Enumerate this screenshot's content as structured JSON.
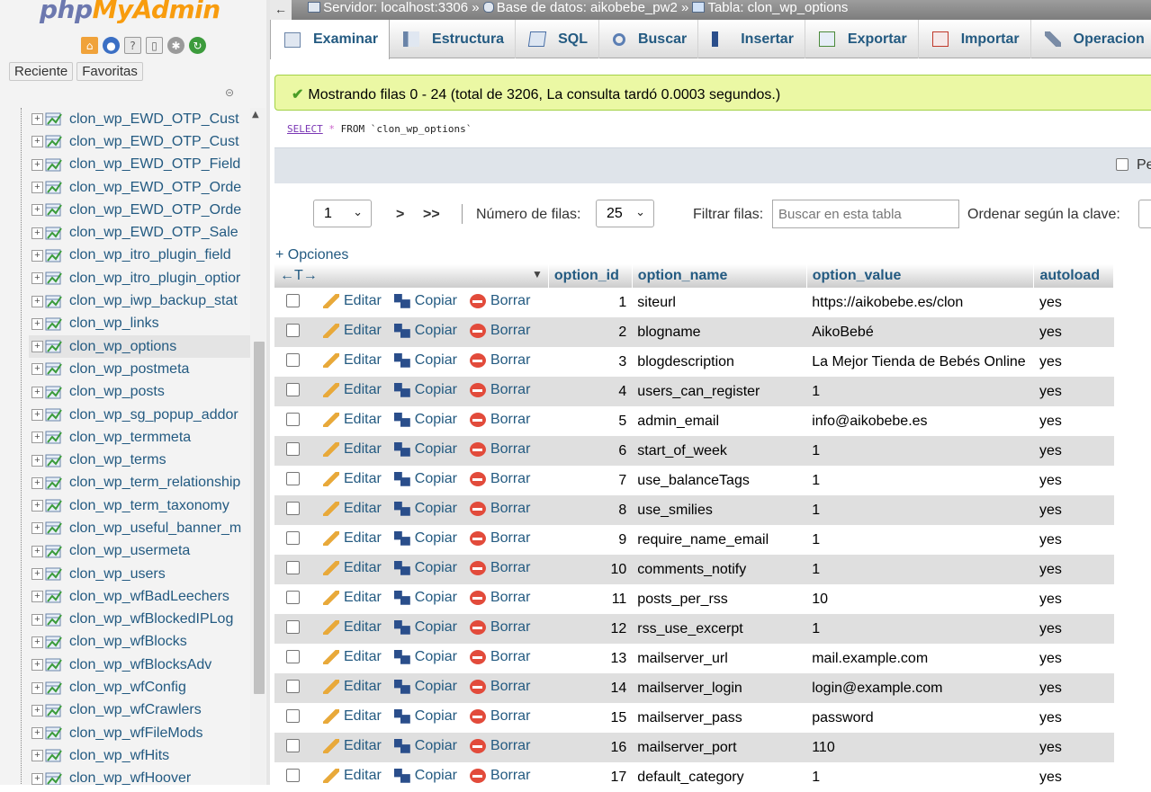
{
  "app": {
    "logo_php": "php",
    "logo_myadmin": "MyAdmin",
    "nav_tabs": [
      "Reciente",
      "Favoritas"
    ]
  },
  "tree": [
    {
      "name": "clon_wp_EWD_OTP_Cust"
    },
    {
      "name": "clon_wp_EWD_OTP_Cust"
    },
    {
      "name": "clon_wp_EWD_OTP_Field"
    },
    {
      "name": "clon_wp_EWD_OTP_Orde"
    },
    {
      "name": "clon_wp_EWD_OTP_Orde"
    },
    {
      "name": "clon_wp_EWD_OTP_Sale"
    },
    {
      "name": "clon_wp_itro_plugin_field"
    },
    {
      "name": "clon_wp_itro_plugin_optior"
    },
    {
      "name": "clon_wp_iwp_backup_stat"
    },
    {
      "name": "clon_wp_links"
    },
    {
      "name": "clon_wp_options",
      "selected": true
    },
    {
      "name": "clon_wp_postmeta"
    },
    {
      "name": "clon_wp_posts"
    },
    {
      "name": "clon_wp_sg_popup_addor"
    },
    {
      "name": "clon_wp_termmeta"
    },
    {
      "name": "clon_wp_terms"
    },
    {
      "name": "clon_wp_term_relationship"
    },
    {
      "name": "clon_wp_term_taxonomy"
    },
    {
      "name": "clon_wp_useful_banner_m"
    },
    {
      "name": "clon_wp_usermeta"
    },
    {
      "name": "clon_wp_users"
    },
    {
      "name": "clon_wp_wfBadLeechers"
    },
    {
      "name": "clon_wp_wfBlockedIPLog"
    },
    {
      "name": "clon_wp_wfBlocks"
    },
    {
      "name": "clon_wp_wfBlocksAdv"
    },
    {
      "name": "clon_wp_wfConfig"
    },
    {
      "name": "clon_wp_wfCrawlers"
    },
    {
      "name": "clon_wp_wfFileMods"
    },
    {
      "name": "clon_wp_wfHits"
    },
    {
      "name": "clon_wp_wfHoover"
    }
  ],
  "breadcrumb": {
    "back": "←",
    "server": "Servidor: localhost:3306",
    "database": "Base de datos: aikobebe_pw2",
    "table": "Tabla: clon_wp_options",
    "sep": "»"
  },
  "tabs": [
    "Examinar",
    "Estructura",
    "SQL",
    "Buscar",
    "Insertar",
    "Exportar",
    "Importar",
    "Operacion"
  ],
  "success_message": "Mostrando filas 0 - 24 (total de 3206, La consulta tardó 0.0003 segundos.)",
  "sql": {
    "select": "SELECT",
    "star": "*",
    "from": "FROM",
    "table": "`clon_wp_options`"
  },
  "sql_bar_label": "Pe",
  "controls": {
    "page": "1",
    "next": ">",
    "last": ">>",
    "rows_label": "Número de filas:",
    "rows_value": "25",
    "filter_label": "Filtrar filas:",
    "filter_placeholder": "Buscar en esta tabla",
    "sort_label": "Ordenar según la clave:"
  },
  "options_link": "+ Opciones",
  "table": {
    "arrows": "←T→",
    "columns": [
      "option_id",
      "option_name",
      "option_value",
      "autoload"
    ],
    "actions": {
      "edit": "Editar",
      "copy": "Copiar",
      "delete": "Borrar"
    },
    "rows": [
      {
        "id": "1",
        "name": "siteurl",
        "value": "https://aikobebe.es/clon",
        "autoload": "yes"
      },
      {
        "id": "2",
        "name": "blogname",
        "value": "AikoBebé",
        "autoload": "yes"
      },
      {
        "id": "3",
        "name": "blogdescription",
        "value": "La Mejor Tienda de Bebés Online",
        "autoload": "yes"
      },
      {
        "id": "4",
        "name": "users_can_register",
        "value": "1",
        "autoload": "yes"
      },
      {
        "id": "5",
        "name": "admin_email",
        "value": "info@aikobebe.es",
        "autoload": "yes"
      },
      {
        "id": "6",
        "name": "start_of_week",
        "value": "1",
        "autoload": "yes"
      },
      {
        "id": "7",
        "name": "use_balanceTags",
        "value": "1",
        "autoload": "yes"
      },
      {
        "id": "8",
        "name": "use_smilies",
        "value": "1",
        "autoload": "yes"
      },
      {
        "id": "9",
        "name": "require_name_email",
        "value": "1",
        "autoload": "yes"
      },
      {
        "id": "10",
        "name": "comments_notify",
        "value": "1",
        "autoload": "yes"
      },
      {
        "id": "11",
        "name": "posts_per_rss",
        "value": "10",
        "autoload": "yes"
      },
      {
        "id": "12",
        "name": "rss_use_excerpt",
        "value": "1",
        "autoload": "yes"
      },
      {
        "id": "13",
        "name": "mailserver_url",
        "value": "mail.example.com",
        "autoload": "yes"
      },
      {
        "id": "14",
        "name": "mailserver_login",
        "value": "login@example.com",
        "autoload": "yes"
      },
      {
        "id": "15",
        "name": "mailserver_pass",
        "value": "password",
        "autoload": "yes"
      },
      {
        "id": "16",
        "name": "mailserver_port",
        "value": "110",
        "autoload": "yes"
      },
      {
        "id": "17",
        "name": "default_category",
        "value": "1",
        "autoload": "yes"
      }
    ]
  },
  "colors": {
    "link": "#235a81",
    "success_bg": "#ebf8a4",
    "row_alt": "#dfdfdf",
    "logo_blue": "#6c78af",
    "logo_orange": "#f89c0e"
  }
}
